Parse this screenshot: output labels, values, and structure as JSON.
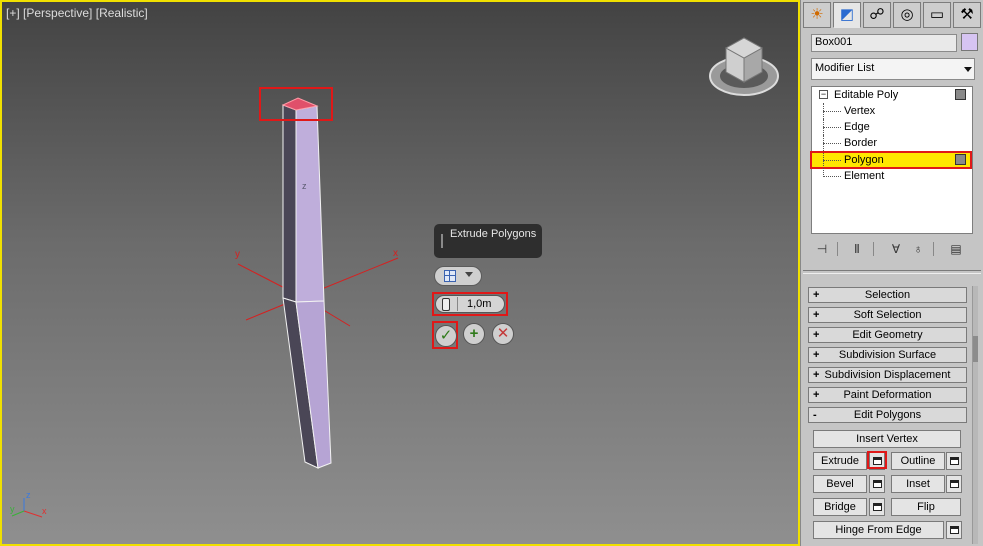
{
  "viewport": {
    "label_plus": "[+]",
    "label_view": "[Perspective]",
    "label_shading": "[Realistic]",
    "gizmo": {
      "x": "x",
      "y": "y",
      "z": "z"
    },
    "axis_tripod": {
      "x": "x",
      "y": "y",
      "z": "z"
    }
  },
  "caddy": {
    "title": "Extrude Polygons",
    "height_value": "1,0m"
  },
  "panel": {
    "tabs": [
      {
        "name": "create-tab",
        "icon": "☀"
      },
      {
        "name": "modify-tab",
        "icon": "◩"
      },
      {
        "name": "hierarchy-tab",
        "icon": "☍"
      },
      {
        "name": "motion-tab",
        "icon": "◎"
      },
      {
        "name": "display-tab",
        "icon": "▭"
      },
      {
        "name": "utilities-tab",
        "icon": "⚒"
      }
    ],
    "object_name": "Box001",
    "object_color": "#d6c4f2",
    "modifier_list": "Modifier List",
    "stack": {
      "root": "Editable Poly",
      "subobjects": [
        "Vertex",
        "Edge",
        "Border",
        "Polygon",
        "Element"
      ],
      "selected": "Polygon"
    },
    "rollouts": [
      {
        "sign": "+",
        "label": "Selection"
      },
      {
        "sign": "+",
        "label": "Soft Selection"
      },
      {
        "sign": "+",
        "label": "Edit Geometry"
      },
      {
        "sign": "+",
        "label": "Subdivision Surface"
      },
      {
        "sign": "+",
        "label": "Subdivision Displacement"
      },
      {
        "sign": "+",
        "label": "Paint Deformation"
      },
      {
        "sign": "-",
        "label": "Edit Polygons"
      }
    ],
    "edit_polygons": {
      "insert_vertex": "Insert Vertex",
      "extrude": "Extrude",
      "outline": "Outline",
      "bevel": "Bevel",
      "inset": "Inset",
      "bridge": "Bridge",
      "flip": "Flip",
      "hinge_from_edge": "Hinge From Edge"
    }
  },
  "colors": {
    "highlight_border": "#e01818",
    "viewport_border": "#f0e000",
    "selection_yellow": "#ffe600"
  }
}
